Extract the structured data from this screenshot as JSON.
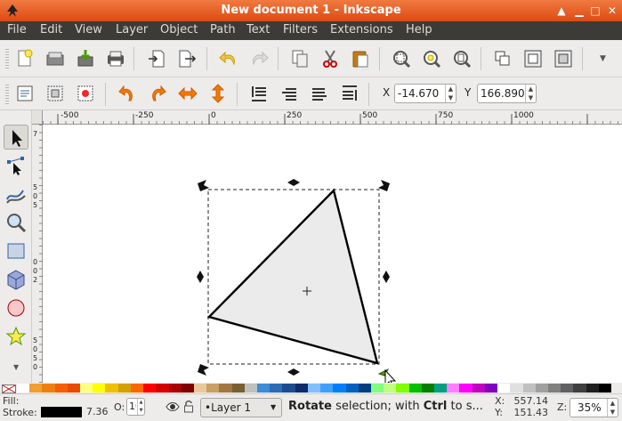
{
  "window": {
    "title": "New document 1 - Inkscape"
  },
  "menu": [
    "File",
    "Edit",
    "View",
    "Layer",
    "Object",
    "Path",
    "Text",
    "Filters",
    "Extensions",
    "Help"
  ],
  "command_bar": {
    "icons": [
      "new-document-icon",
      "open-icon",
      "import-icon",
      "print-icon",
      "import-doc-icon",
      "export-icon",
      "undo-icon",
      "redo-icon",
      "duplicate-icon",
      "cut-icon",
      "paste-icon",
      "zoom-selection-icon",
      "zoom-drawing-icon",
      "zoom-page-icon",
      "group-icon",
      "ungroup-icon",
      "clone-icon"
    ]
  },
  "controls": {
    "x_label": "X",
    "x_value": "-14.670",
    "y_label": "Y",
    "y_value": "166.890"
  },
  "ruler": {
    "h_ticks": [
      "-500",
      "-250",
      "0",
      "250",
      "500",
      "750",
      "1000"
    ],
    "v_ticks": [
      "7",
      "5",
      "0",
      "5",
      "0",
      "0",
      "2",
      "5",
      "0",
      "5",
      "0"
    ]
  },
  "palette": {
    "colors": [
      "#ffffff",
      "#f0a030",
      "#ef8010",
      "#f45f00",
      "#e84a00",
      "#ffff80",
      "#ffff00",
      "#f0c000",
      "#d4a000",
      "#ff6600",
      "#ff0000",
      "#d40000",
      "#aa0000",
      "#800000",
      "#e9c8a0",
      "#c8a064",
      "#a07840",
      "#786030",
      "#c0c0c0",
      "#3c8cd8",
      "#2c6cb4",
      "#1c4c90",
      "#0c2c6c",
      "#80c0ff",
      "#40a0ff",
      "#0080ff",
      "#0060c0",
      "#00407f",
      "#80ff80",
      "#c0ff80",
      "#80ff00",
      "#00c000",
      "#008000",
      "#00a080",
      "#ff80ff",
      "#ff00ff",
      "#c000c0",
      "#8000c0",
      "#ffffff",
      "#e0e0e0",
      "#c0c0c0",
      "#a0a0a0",
      "#808080",
      "#606060",
      "#404040",
      "#202020",
      "#000000"
    ]
  },
  "status": {
    "fill_label": "Fill:",
    "stroke_label": "Stroke:",
    "stroke_width": "7.36",
    "opacity_label": "O:",
    "opacity_value": "10",
    "layer_value": "•Layer 1",
    "message_bold": "Rotate",
    "message_rest": " selection; with ",
    "message_bold2": "Ctrl",
    "message_tail": " to s...",
    "x_coord_label": "X:",
    "x_coord": "557.14",
    "y_coord_label": "Y:",
    "y_coord": "151.43",
    "zoom_label": "Z:",
    "zoom_value": "35%"
  }
}
